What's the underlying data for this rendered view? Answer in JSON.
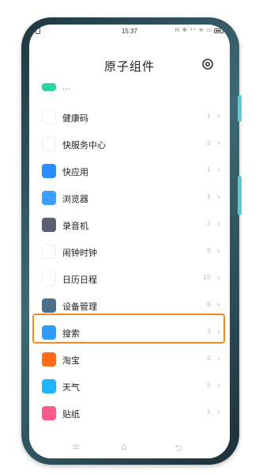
{
  "status": {
    "time": "15:37",
    "indicators": "N ✻ ⁴⁶ ≋ ▭"
  },
  "header": {
    "title": "原子组件"
  },
  "list": {
    "partial_label": "...",
    "items": [
      {
        "label": "健康码",
        "count": "1",
        "icon": "health-code-icon",
        "color": "#ffffff"
      },
      {
        "label": "快服务中心",
        "count": "2",
        "icon": "quick-service-icon",
        "color": "#ffffff"
      },
      {
        "label": "快应用",
        "count": "1",
        "icon": "quick-app-icon",
        "color": "#2b8cff"
      },
      {
        "label": "浏览器",
        "count": "1",
        "icon": "browser-icon",
        "color": "#3aa0ff"
      },
      {
        "label": "录音机",
        "count": "2",
        "icon": "recorder-icon",
        "color": "#5a5f73"
      },
      {
        "label": "闹钟时钟",
        "count": "8",
        "icon": "clock-icon",
        "color": "#ffffff"
      },
      {
        "label": "日历日程",
        "count": "10",
        "icon": "calendar-icon",
        "color": "#ffffff"
      },
      {
        "label": "设备管理",
        "count": "6",
        "icon": "device-manager-icon",
        "color": "#4c6f8c"
      },
      {
        "label": "搜索",
        "count": "3",
        "icon": "search-icon",
        "color": "#2f9bff"
      },
      {
        "label": "淘宝",
        "count": "2",
        "icon": "taobao-icon",
        "color": "#ff6a1a"
      },
      {
        "label": "天气",
        "count": "5",
        "icon": "weather-icon",
        "color": "#1fb6ff"
      },
      {
        "label": "贴纸",
        "count": "5",
        "icon": "sticker-icon",
        "color": "#ff5b8a"
      }
    ]
  },
  "highlight_color": "#f08a24"
}
